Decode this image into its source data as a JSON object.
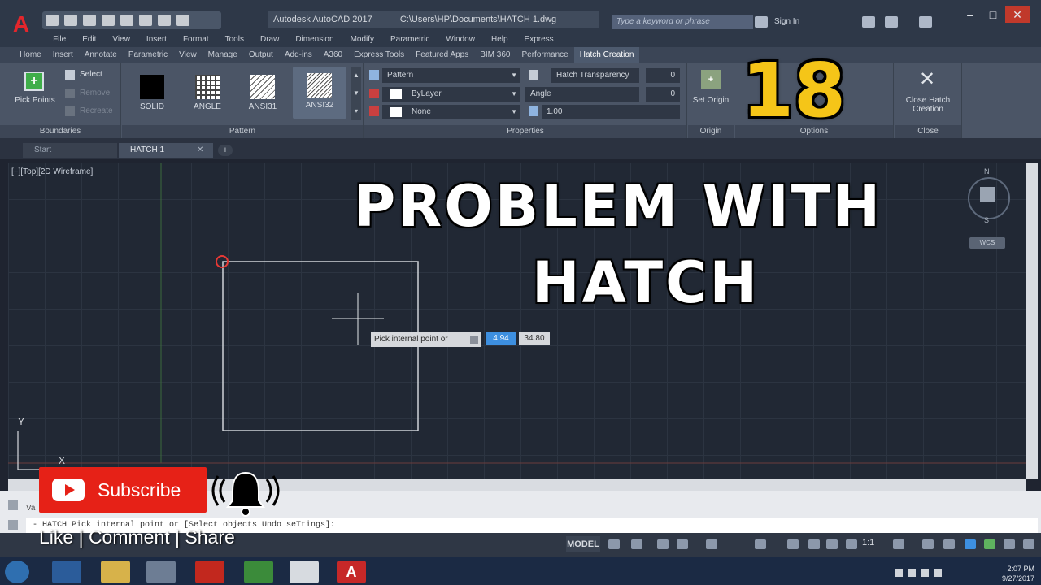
{
  "titlebar": {
    "app_title": "Autodesk AutoCAD 2017",
    "file_path": "C:\\Users\\HP\\Documents\\HATCH 1.dwg",
    "search_placeholder": "Type a keyword or phrase",
    "sign_in": "Sign In"
  },
  "menubar": [
    "File",
    "Edit",
    "View",
    "Insert",
    "Format",
    "Tools",
    "Draw",
    "Dimension",
    "Modify",
    "Parametric",
    "Window",
    "Help",
    "Express"
  ],
  "ribbon_tabs": [
    "Home",
    "Insert",
    "Annotate",
    "Parametric",
    "View",
    "Manage",
    "Output",
    "Add-ins",
    "A360",
    "Express Tools",
    "Featured Apps",
    "BIM 360",
    "Performance",
    "Hatch Creation"
  ],
  "active_ribbon_tab": "Hatch Creation",
  "boundaries": {
    "pick_points": "Pick Points",
    "select": "Select",
    "remove": "Remove",
    "recreate": "Recreate",
    "title": "Boundaries"
  },
  "pattern_panel": {
    "title": "Pattern",
    "swatches": [
      {
        "label": "SOLID"
      },
      {
        "label": "ANGLE"
      },
      {
        "label": "ANSI31"
      },
      {
        "label": "ANSI32",
        "selected": true
      }
    ]
  },
  "properties_panel": {
    "title": "Properties",
    "hatch_type": "Pattern",
    "color": "ByLayer",
    "background": "None",
    "transparency_label": "Hatch Transparency",
    "transparency_value": "0",
    "angle_label": "Angle",
    "angle_value": "0",
    "scale_value": "1.00"
  },
  "origin_panel": {
    "set_origin": "Set Origin",
    "title": "Origin"
  },
  "options_panel": {
    "title": "Options"
  },
  "close_panel": {
    "close_label": "Close Hatch Creation",
    "title": "Close"
  },
  "doc_tabs": {
    "start": "Start",
    "file": "HATCH 1"
  },
  "viewport": {
    "view_label": "[−][Top][2D Wireframe]",
    "compass_n": "N",
    "compass_s": "S",
    "view_cube_label": "WCS",
    "axis_y": "Y",
    "axis_x": "X"
  },
  "tooltip": {
    "prompt": "Pick internal point or",
    "x_value": "4.94",
    "y_value": "34.80"
  },
  "overlay": {
    "episode": "18",
    "headline_line1": "PROBLEM WITH",
    "headline_line2": "HATCH",
    "subscribe": "Subscribe",
    "social": "Like | Comment | Share"
  },
  "command_line": {
    "text": "- HATCH Pick internal point or [Select objects Undo seTtings]:",
    "previous": "Va"
  },
  "statusbar": {
    "model": "MODEL",
    "scale": "1:1"
  },
  "taskbar": {
    "time": "2:07 PM",
    "date": "9/27/2017"
  },
  "colors": {
    "accent": "#e3262c",
    "episode": "#f5c518",
    "subscribe": "#e62117",
    "canvas": "#212834"
  }
}
